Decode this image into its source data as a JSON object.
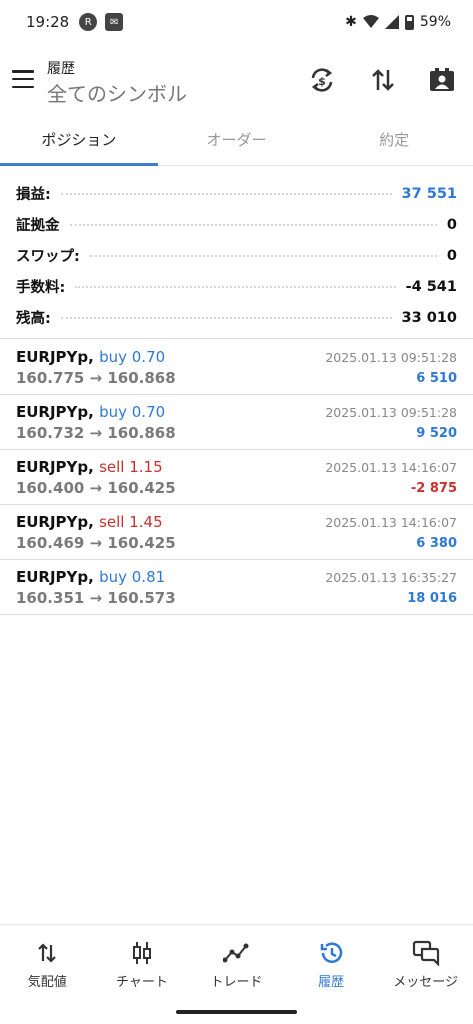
{
  "status_bar": {
    "time": "19:28",
    "battery": "59%"
  },
  "header": {
    "subtitle": "履歴",
    "title": "全てのシンボル"
  },
  "tabs": [
    {
      "label": "ポジション",
      "active": true
    },
    {
      "label": "オーダー",
      "active": false
    },
    {
      "label": "約定",
      "active": false
    }
  ],
  "summary": [
    {
      "label": "損益:",
      "value": "37 551"
    },
    {
      "label": "証拠金",
      "value": "0"
    },
    {
      "label": "スワップ:",
      "value": "0"
    },
    {
      "label": "手数料:",
      "value": "-4 541"
    },
    {
      "label": "残高:",
      "value": "33 010"
    }
  ],
  "deals": [
    {
      "symbol": "EURJPYp,",
      "side": "buy 0.70",
      "prices": "160.775 → 160.868",
      "time": "2025.01.13 09:51:28",
      "profit": "6 510"
    },
    {
      "symbol": "EURJPYp,",
      "side": "buy 0.70",
      "prices": "160.732 → 160.868",
      "time": "2025.01.13 09:51:28",
      "profit": "9 520"
    },
    {
      "symbol": "EURJPYp,",
      "side": "sell 1.15",
      "prices": "160.400 → 160.425",
      "time": "2025.01.13 14:16:07",
      "profit": "-2 875"
    },
    {
      "symbol": "EURJPYp,",
      "side": "sell 1.45",
      "prices": "160.469 → 160.425",
      "time": "2025.01.13 14:16:07",
      "profit": "6 380"
    },
    {
      "symbol": "EURJPYp,",
      "side": "buy 0.81",
      "prices": "160.351 → 160.573",
      "time": "2025.01.13 16:35:27",
      "profit": "18 016"
    }
  ],
  "bottom_nav": [
    {
      "label": "気配値",
      "icon": "quotes-icon"
    },
    {
      "label": "チャート",
      "icon": "chart-icon"
    },
    {
      "label": "トレード",
      "icon": "trade-icon"
    },
    {
      "label": "履歴",
      "icon": "history-icon",
      "active": true
    },
    {
      "label": "メッセージ",
      "icon": "messages-icon"
    }
  ],
  "colors": {
    "accent": "#2f79d6",
    "negative": "#c8312e"
  }
}
